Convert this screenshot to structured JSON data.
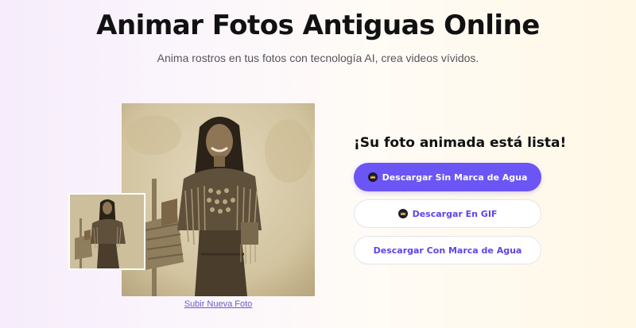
{
  "header": {
    "title": "Animar Fotos Antiguas Online",
    "subtitle": "Anima rostros en tus fotos con tecnología AI, crea videos vívidos."
  },
  "preview": {
    "upload_link": "Subir Nueva Foto"
  },
  "result": {
    "heading": "¡Su foto animada está lista!",
    "buttons": [
      {
        "label": "Descargar Sin Marca de Agua",
        "icon": "crown-icon",
        "style": "primary"
      },
      {
        "label": "Descargar En GIF",
        "icon": "crown-icon",
        "style": "outline"
      },
      {
        "label": "Descargar Con Marca de Agua",
        "icon": "",
        "style": "outline"
      }
    ]
  },
  "colors": {
    "accent": "#6b55f5",
    "accent_text": "#5c45ea",
    "link": "#6a5ac7",
    "title": "#111111",
    "subtitle": "#55555f",
    "photo_sepia": "#cdbf9c"
  }
}
